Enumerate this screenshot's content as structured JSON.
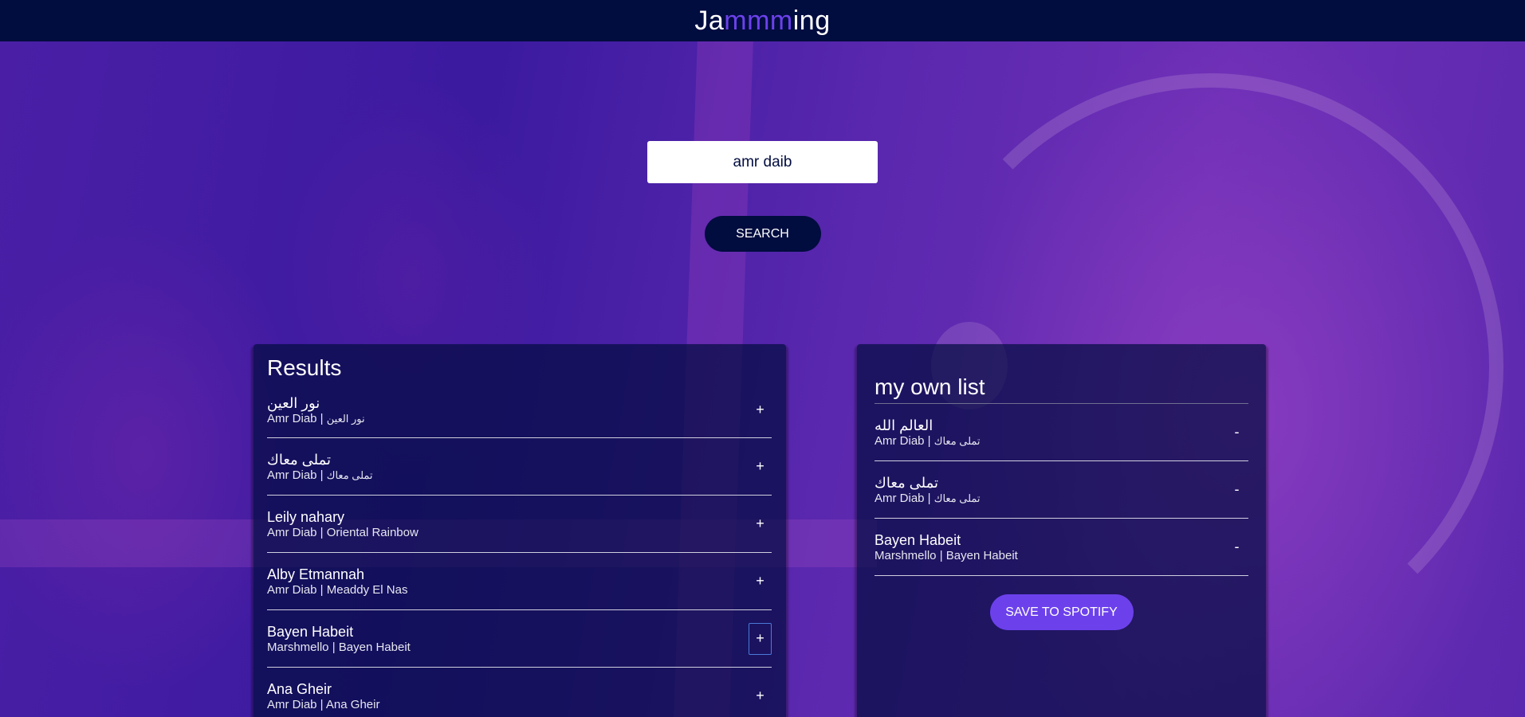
{
  "header": {
    "logo_part1": "Ja",
    "logo_highlight": "mmm",
    "logo_part2": "ing"
  },
  "search": {
    "value": "amr daib",
    "button_label": "SEARCH"
  },
  "results": {
    "title": "Results",
    "tracks": [
      {
        "name": "نور العين",
        "artist": "Amr Diab",
        "album": "نور العين",
        "action": "+"
      },
      {
        "name": "تملى معاك",
        "artist": "Amr Diab",
        "album": "تملى معاك",
        "action": "+"
      },
      {
        "name": "Leily nahary",
        "artist": "Amr Diab",
        "album": "Oriental Rainbow",
        "action": "+"
      },
      {
        "name": "Alby Etmannah",
        "artist": "Amr Diab",
        "album": "Meaddy El Nas",
        "action": "+"
      },
      {
        "name": "Bayen Habeit",
        "artist": "Marshmello",
        "album": "Bayen Habeit",
        "action": "+"
      },
      {
        "name": "Ana Gheir",
        "artist": "Amr Diab",
        "album": "Ana Gheir",
        "action": "+"
      }
    ]
  },
  "playlist": {
    "name": "my own list",
    "tracks": [
      {
        "name": "العالم الله",
        "artist": "Amr Diab",
        "album": "تملى معاك",
        "action": "-"
      },
      {
        "name": "تملى معاك",
        "artist": "Amr Diab",
        "album": "تملى معاك",
        "action": "-"
      },
      {
        "name": "Bayen Habeit",
        "artist": "Marshmello",
        "album": "Bayen Habeit",
        "action": "-"
      }
    ],
    "save_label": "SAVE TO SPOTIFY"
  },
  "separator": " | ",
  "colors": {
    "header_bg": "#010c3f",
    "accent": "#6c41ec",
    "panel_bg": "rgba(1,12,63,0.7)"
  }
}
